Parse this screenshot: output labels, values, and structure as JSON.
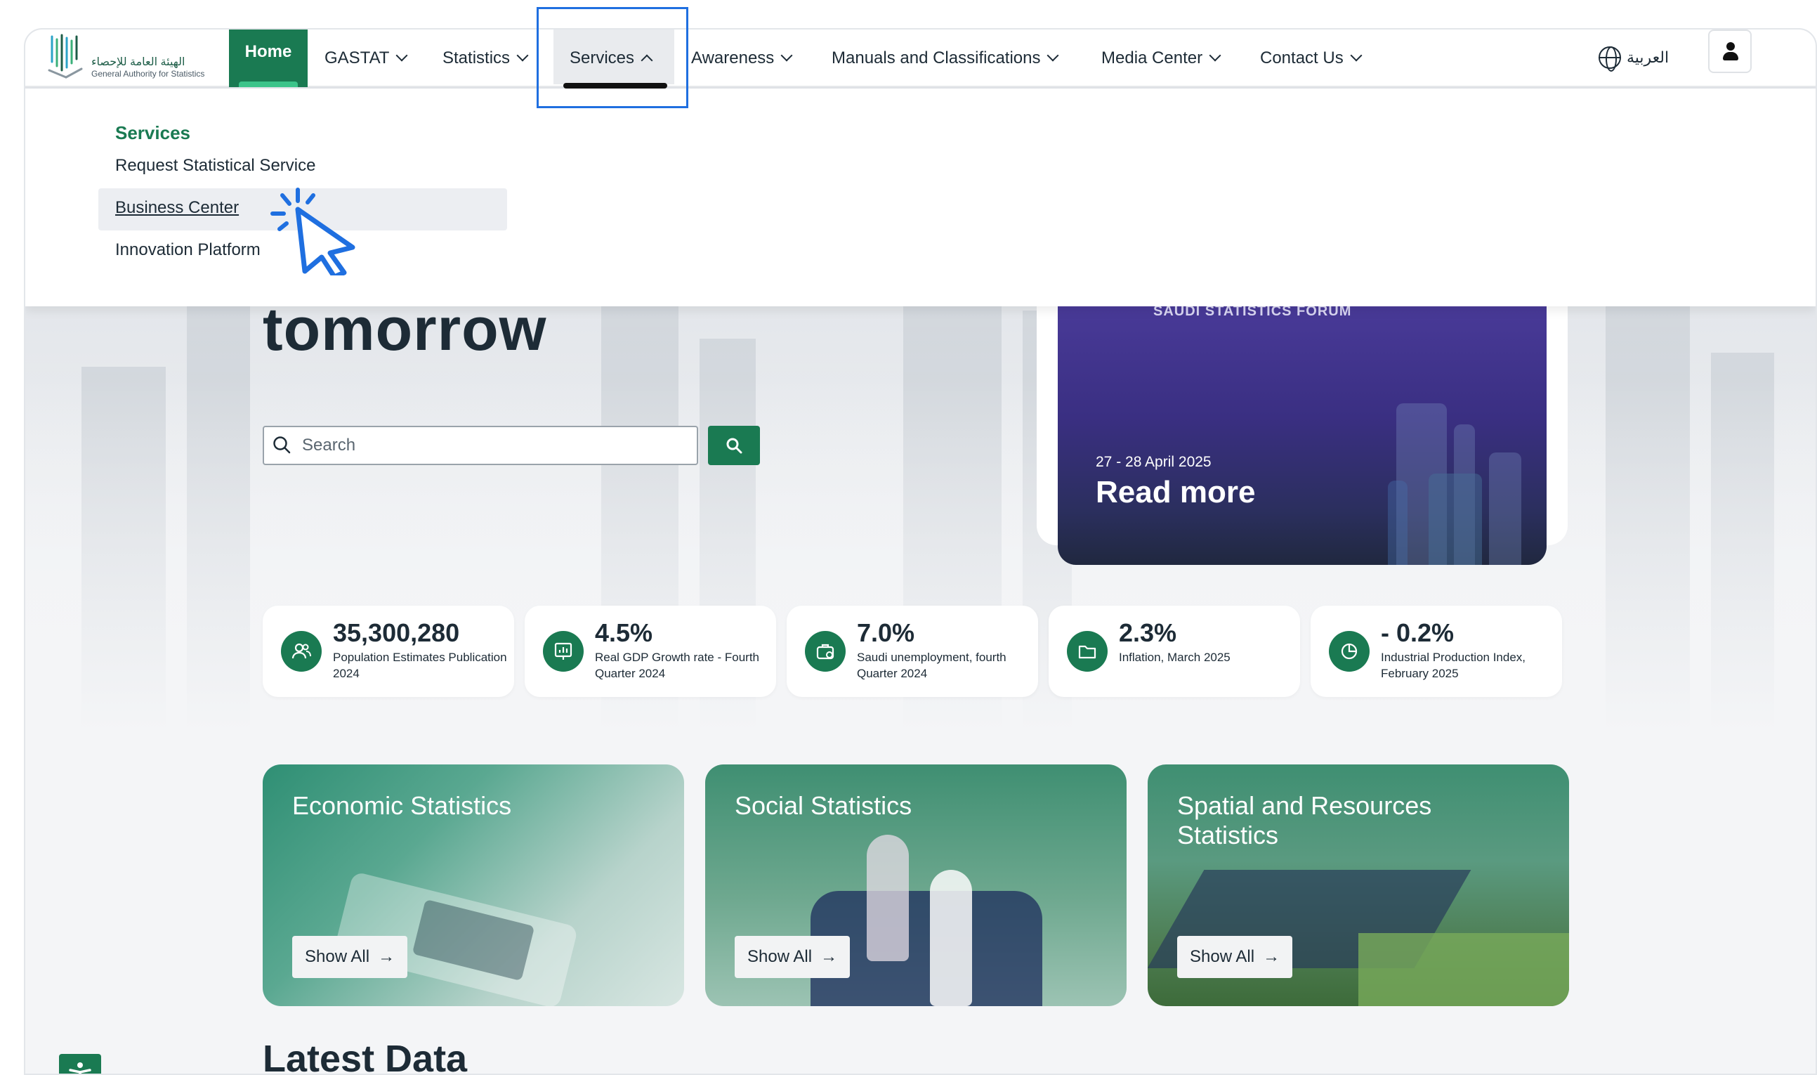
{
  "header": {
    "logo_ar": "الهيئة العامة للإحصاء",
    "logo_en": "General Authority for Statistics",
    "nav": [
      {
        "label": "Home"
      },
      {
        "label": "GASTAT"
      },
      {
        "label": "Statistics"
      },
      {
        "label": "Services"
      },
      {
        "label": "Awareness"
      },
      {
        "label": "Manuals and Classifications"
      },
      {
        "label": "Media Center"
      },
      {
        "label": "Contact Us"
      }
    ],
    "language": "العربية"
  },
  "dropdown": {
    "title": "Services",
    "items": [
      {
        "label": "Request Statistical Service"
      },
      {
        "label": "Business Center"
      },
      {
        "label": "Innovation Platform"
      }
    ]
  },
  "hero": {
    "title_fragment": "tomorrow",
    "search_placeholder": "Search"
  },
  "event": {
    "forum": "SAUDI STATISTICS FORUM",
    "date": "27 - 28 April 2025",
    "cta": "Read more"
  },
  "stats": [
    {
      "value": "35,300,280",
      "label": "Population Estimates Publication 2024",
      "icon": "people-icon"
    },
    {
      "value": "4.5%",
      "label": "Real GDP Growth rate - Fourth Quarter 2024",
      "icon": "presentation-chart-icon"
    },
    {
      "value": "7.0%",
      "label": "Saudi unemployment, fourth Quarter 2024",
      "icon": "briefcase-icon"
    },
    {
      "value": "2.3%",
      "label": "Inflation, March 2025",
      "icon": "folder-icon"
    },
    {
      "value": "- 0.2%",
      "label": "Industrial Production Index, February 2025",
      "icon": "pie-chart-icon"
    }
  ],
  "categories": [
    {
      "title": "Economic Statistics",
      "button": "Show All"
    },
    {
      "title": "Social Statistics",
      "button": "Show All"
    },
    {
      "title": "Spatial and Resources Statistics",
      "button": "Show All"
    }
  ],
  "latest_heading": "Latest Data",
  "colors": {
    "brand_green": "#1a7a52",
    "highlight_blue": "#1f6fe0"
  }
}
